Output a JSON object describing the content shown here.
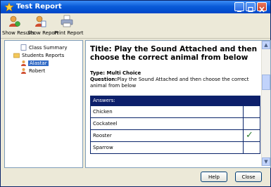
{
  "window": {
    "title": "Test Report",
    "controls": {
      "minimize": "minimize-icon",
      "maximize": "maximize-icon",
      "close": "close-icon"
    }
  },
  "toolbar": {
    "items": [
      {
        "label": "Show Results",
        "icon": "results-icon"
      },
      {
        "label": "Show Report",
        "icon": "report-icon"
      },
      {
        "label": "Print Report",
        "icon": "printer-icon"
      }
    ]
  },
  "tree": {
    "items": [
      {
        "label": "Class Summary",
        "icon": "document-icon"
      },
      {
        "label": "Students Reports",
        "icon": "folder-icon"
      },
      {
        "label": "Alastar",
        "icon": "student-icon",
        "selected": true
      },
      {
        "label": "Robert",
        "icon": "student-icon"
      }
    ]
  },
  "question": {
    "title": "Title: Play the Sound Attached and then choose the correct animal from below",
    "type_label": "Type: Multi Choice",
    "question_label": "Question:",
    "question_text": "Play the Sound Attached and then choose the correct animal from below",
    "answers_header": "Answers:",
    "answers": [
      {
        "text": "Chicken",
        "correct": false
      },
      {
        "text": "Cockateel",
        "correct": false
      },
      {
        "text": "Rooster",
        "correct": true,
        "mark": "✓"
      },
      {
        "text": "Sparrow",
        "correct": false
      }
    ]
  },
  "buttons": {
    "help": "Help",
    "close": "Close"
  },
  "colors": {
    "titlebar": "#0a5bd8",
    "answers_header": "#0d1f6b",
    "selection": "#316ac5"
  }
}
